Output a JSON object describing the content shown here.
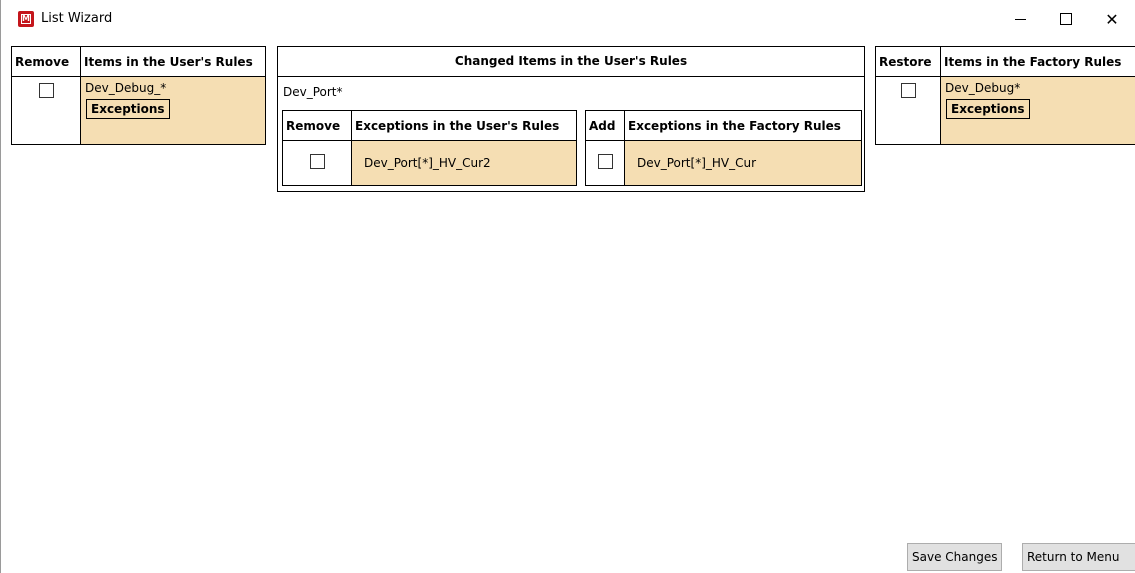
{
  "window": {
    "title": "List Wizard",
    "icon": "app-logo-icon",
    "controls": [
      "minimize-icon",
      "maximize-icon",
      "close-icon"
    ]
  },
  "user_rules": {
    "remove_header": "Remove",
    "items_header": "Items in the User's Rules",
    "rows": [
      {
        "checked": false,
        "item": "Dev_Debug_*",
        "exceptions_label": "Exceptions"
      }
    ]
  },
  "changed_items": {
    "header": "Changed Items in the User's Rules",
    "item": "Dev_Port*",
    "user_exceptions": {
      "remove_header": "Remove",
      "header": "Exceptions in the User's Rules",
      "rows": [
        {
          "checked": false,
          "value": "Dev_Port[*]_HV_Cur2"
        }
      ]
    },
    "factory_exceptions": {
      "add_header": "Add",
      "header": "Exceptions in the Factory Rules",
      "rows": [
        {
          "checked": false,
          "value": "Dev_Port[*]_HV_Cur"
        }
      ]
    }
  },
  "factory_rules": {
    "restore_header": "Restore",
    "items_header": "Items in the Factory Rules",
    "rows": [
      {
        "checked": false,
        "item": "Dev_Debug*",
        "exceptions_label": "Exceptions"
      }
    ]
  },
  "footer": {
    "save_label": "Save Changes",
    "return_label": "Return to Menu"
  },
  "colors": {
    "cell_tan": "#f5deb3",
    "border": "#000000",
    "app_icon": "#c4161c"
  }
}
